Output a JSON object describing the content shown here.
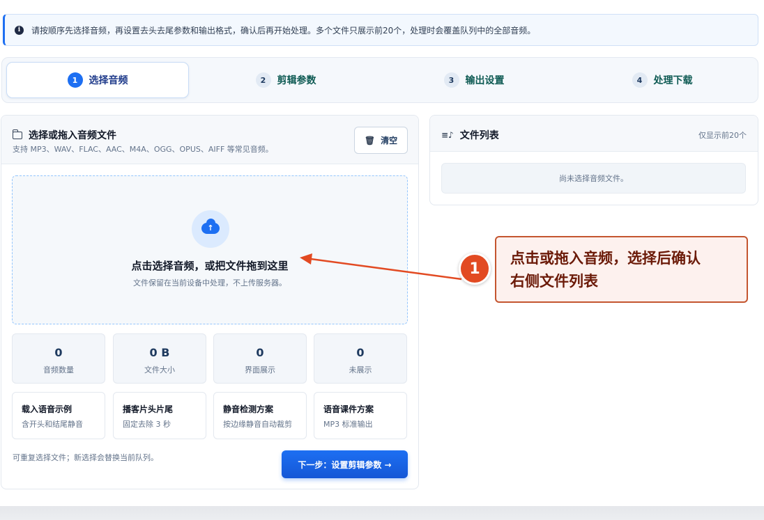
{
  "notice": {
    "text": "请按顺序先选择音频，再设置去头去尾参数和输出格式，确认后再开始处理。多个文件只展示前20个，处理时会覆盖队列中的全部音频。"
  },
  "steps": [
    {
      "num": "1",
      "label": "选择音频",
      "active": true
    },
    {
      "num": "2",
      "label": "剪辑参数",
      "active": false
    },
    {
      "num": "3",
      "label": "输出设置",
      "active": false
    },
    {
      "num": "4",
      "label": "处理下载",
      "active": false
    }
  ],
  "upload_card": {
    "title": "选择或拖入音频文件",
    "subtitle": "支持 MP3、WAV、FLAC、AAC、M4A、OGG、OPUS、AIFF 等常见音频。",
    "clear_label": "清空",
    "dropzone_title": "点击选择音频，或把文件拖到这里",
    "dropzone_sub": "文件保留在当前设备中处理，不上传服务器。",
    "stats": [
      {
        "value": "0",
        "label": "音频数量"
      },
      {
        "value": "0 B",
        "label": "文件大小"
      },
      {
        "value": "0",
        "label": "界面展示"
      },
      {
        "value": "0",
        "label": "未展示"
      }
    ],
    "presets": [
      {
        "title": "载入语音示例",
        "desc": "含开头和结尾静音"
      },
      {
        "title": "播客片头片尾",
        "desc": "固定去除 3 秒"
      },
      {
        "title": "静音检测方案",
        "desc": "按边缘静音自动裁剪"
      },
      {
        "title": "语音课件方案",
        "desc": "MP3 标准输出"
      }
    ],
    "footnote": "可重复选择文件；新选择会替换当前队列。",
    "next_label": "下一步：设置剪辑参数 →"
  },
  "file_list": {
    "title": "文件列表",
    "hint": "仅显示前20个",
    "empty_text": "尚未选择音频文件。"
  },
  "annotation": {
    "badge": "1",
    "text_line1": "点击或拖入音频，选择后确认",
    "text_line2": "右侧文件列表"
  },
  "colors": {
    "primary": "#1d6ff2",
    "annotation_red": "#e24a22"
  }
}
